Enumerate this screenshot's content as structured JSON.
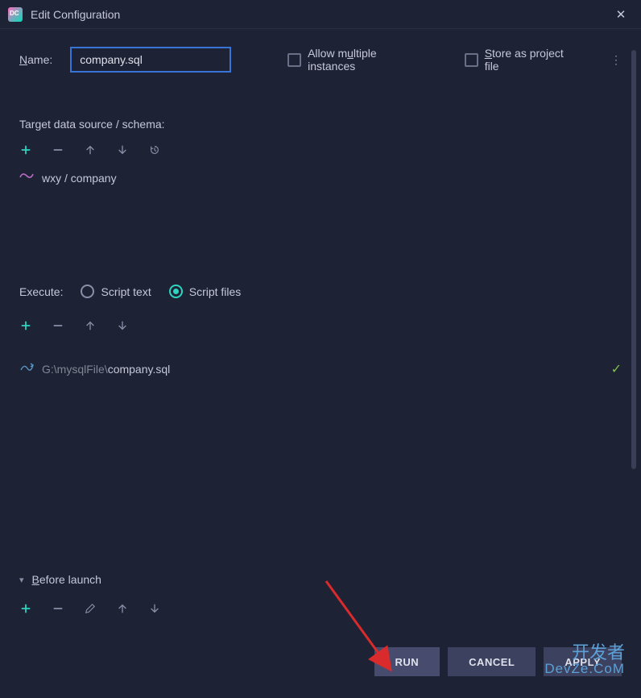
{
  "window": {
    "title": "Edit Configuration"
  },
  "name": {
    "label_html": "Name:",
    "value": "company.sql"
  },
  "options": {
    "allow_multiple": "Allow multiple instances",
    "store_as_project": "Store as project file"
  },
  "target": {
    "label": "Target data source / schema:",
    "path": "wxy / company"
  },
  "execute": {
    "label": "Execute:",
    "option_text": "Script text",
    "option_files": "Script files",
    "selected": "files"
  },
  "script_file": {
    "dir": "G:\\mysqlFile\\",
    "name": "company.sql"
  },
  "before_launch": {
    "label": "Before launch"
  },
  "buttons": {
    "run": "RUN",
    "cancel": "CANCEL",
    "apply": "APPLY"
  },
  "watermark": {
    "line1": "开发者",
    "line2": "DevZe.CoM"
  }
}
